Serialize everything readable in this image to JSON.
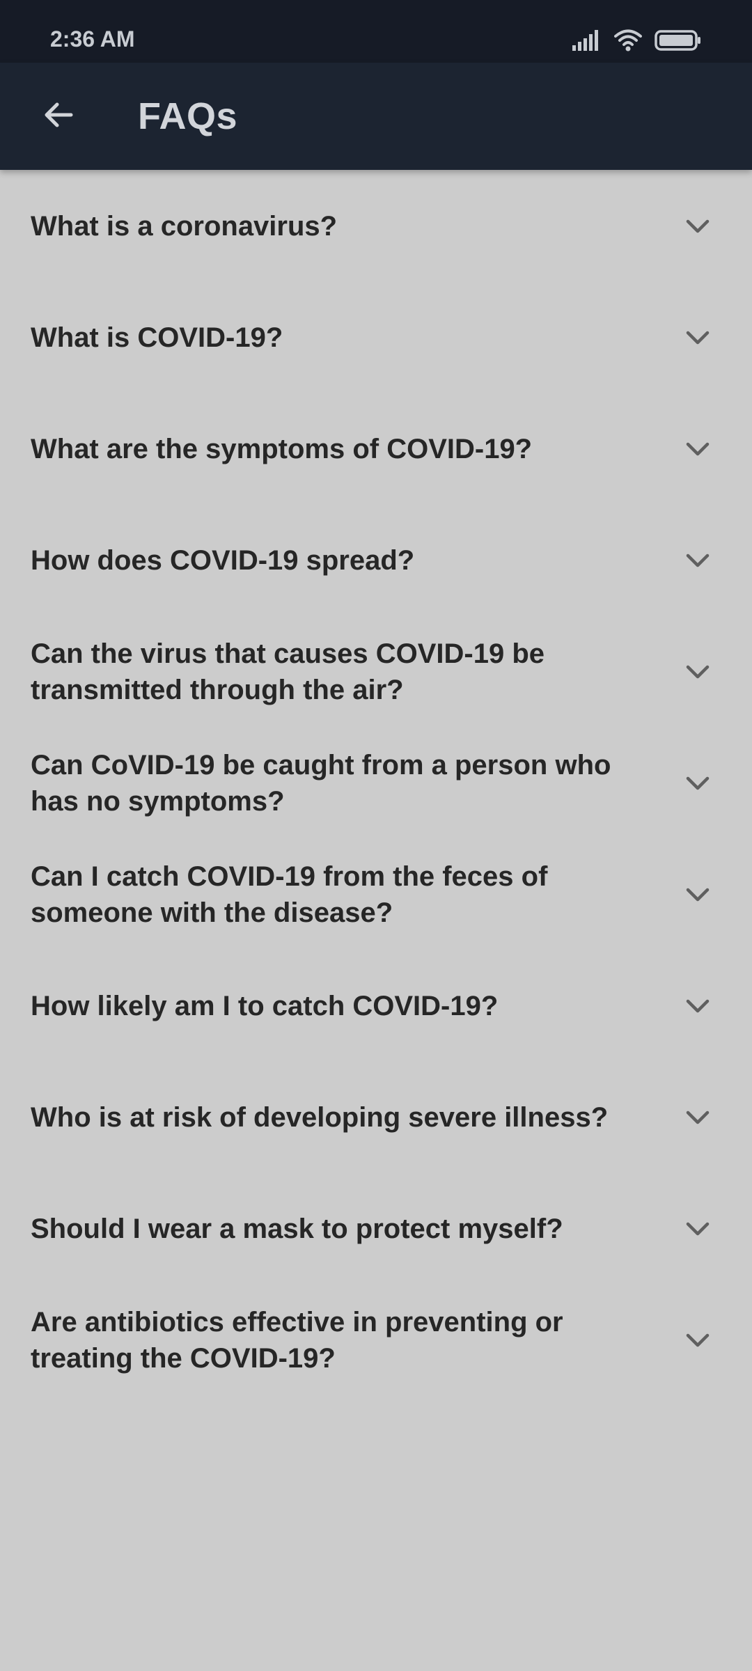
{
  "status_bar": {
    "time": "2:36 AM",
    "icons": [
      "signal-icon",
      "wifi-icon",
      "battery-icon"
    ]
  },
  "app_bar": {
    "back_icon": "arrow-left-icon",
    "title": "FAQs"
  },
  "faq": {
    "items": [
      {
        "question": "What is a coronavirus?"
      },
      {
        "question": "What is COVID-19?"
      },
      {
        "question": "What are the symptoms of COVID-19?"
      },
      {
        "question": "How does COVID-19 spread?"
      },
      {
        "question": "Can the virus that causes COVID-19 be transmitted through the air?"
      },
      {
        "question": "Can CoVID-19 be caught from a person who has no symptoms?"
      },
      {
        "question": "Can I catch COVID-19 from the feces of someone with the disease?"
      },
      {
        "question": "How likely am I to catch COVID-19?"
      },
      {
        "question": "Who is at risk of developing severe illness?"
      },
      {
        "question": "Should I wear a mask to protect myself?"
      },
      {
        "question": "Are antibiotics effective in preventing or treating the COVID-19?"
      }
    ],
    "expand_icon": "chevron-down-icon"
  },
  "colors": {
    "status_bar_bg": "#161b26",
    "app_bar_bg": "#1c2431",
    "page_bg": "#cccccc",
    "question_text": "#262626",
    "chevron": "#5f5f5f"
  }
}
